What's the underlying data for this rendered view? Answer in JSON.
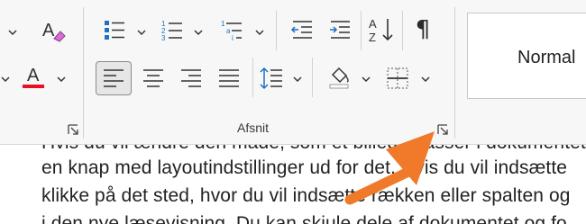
{
  "ribbon": {
    "paragraph_group_label": "Afsnit",
    "styles": {
      "normal_label": "Normal"
    },
    "pilcrow": "¶"
  },
  "document": {
    "lines": [
      "Hvis du vil ændre den måde, som et billede passer i dokumentet, skal du",
      "en knap med layoutindstillinger ud for det. Hvis du vil indsætte",
      "klikke på det sted, hvor du vil indsætte rækken eller spalten og",
      "i den nye læsevisning. Du kan skjule dele af dokumentet og fo"
    ]
  },
  "colors": {
    "font_color_bar": "#e81123",
    "accent_blue": "#1f6fc5",
    "arrow_orange": "#f07a2a"
  }
}
